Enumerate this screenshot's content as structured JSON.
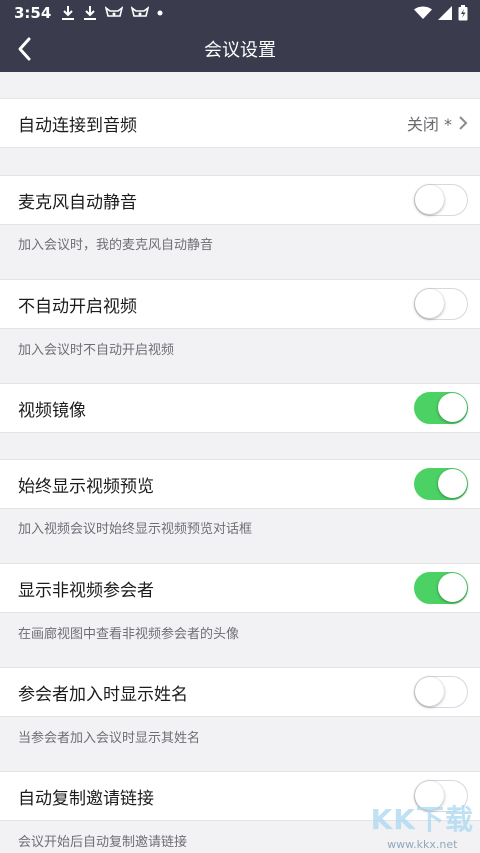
{
  "status_bar": {
    "time": "3:54",
    "notification_icons": [
      "download-icon",
      "download-icon",
      "app-icon",
      "app-icon",
      "dot-icon"
    ],
    "right_icons": [
      "wifi-icon",
      "signal-icon",
      "battery-icon"
    ]
  },
  "nav": {
    "title": "会议设置",
    "back_icon": "chevron-left-icon"
  },
  "settings": {
    "auto_connect_audio": {
      "label": "自动连接到音频",
      "value": "关闭 *"
    },
    "mute_mic": {
      "label": "麦克风自动静音",
      "description": "加入会议时，我的麦克风自动静音",
      "enabled": false
    },
    "no_auto_video": {
      "label": "不自动开启视频",
      "description": "加入会议时不自动开启视频",
      "enabled": false
    },
    "video_mirror": {
      "label": "视频镜像",
      "enabled": true
    },
    "always_preview": {
      "label": "始终显示视频预览",
      "description": "加入视频会议时始终显示视频预览对话框",
      "enabled": true
    },
    "show_non_video": {
      "label": "显示非视频参会者",
      "description": "在画廊视图中查看非视频参会者的头像",
      "enabled": true
    },
    "show_names": {
      "label": "参会者加入时显示姓名",
      "description": "当参会者加入会议时显示其姓名",
      "enabled": false
    },
    "copy_invite": {
      "label": "自动复制邀请链接",
      "description": "会议开始后自动复制邀请链接",
      "enabled": false
    }
  },
  "colors": {
    "header_bg": "#3a3c4d",
    "toggle_on": "#4cd264",
    "page_bg": "#f2f2f5"
  },
  "watermark": {
    "text": "KK下载",
    "url": "www.kkx.net"
  }
}
